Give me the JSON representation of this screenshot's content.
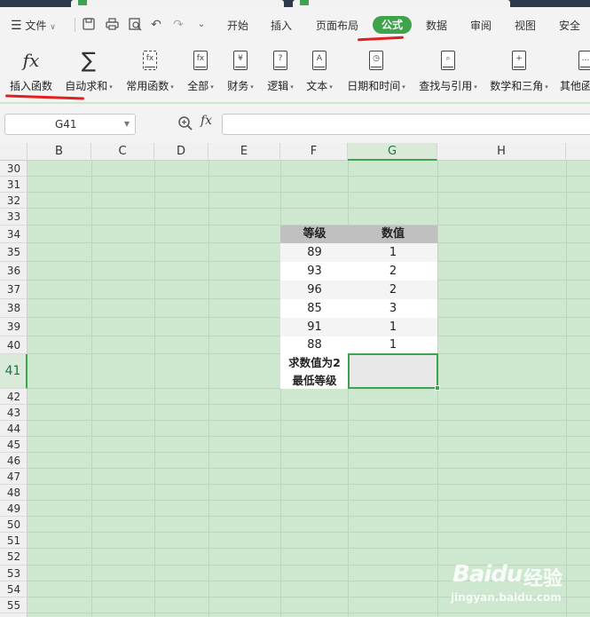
{
  "menu": {
    "file_label": "文件",
    "tabs": [
      "开始",
      "插入",
      "页面布局",
      "公式",
      "数据",
      "审阅",
      "视图",
      "安全"
    ],
    "active_tab": "公式"
  },
  "ribbon": {
    "items": [
      {
        "label": "插入函数",
        "icon": "fx-icon",
        "dropdown": false
      },
      {
        "label": "自动求和",
        "icon": "sigma-icon",
        "dropdown": true
      },
      {
        "label": "常用函数",
        "icon": "star-function-icon",
        "dropdown": true
      },
      {
        "label": "全部",
        "icon": "fx-book-icon",
        "dropdown": true
      },
      {
        "label": "财务",
        "icon": "yen-book-icon",
        "dropdown": true
      },
      {
        "label": "逻辑",
        "icon": "question-book-icon",
        "dropdown": true
      },
      {
        "label": "文本",
        "icon": "text-book-icon",
        "dropdown": true
      },
      {
        "label": "日期和时间",
        "icon": "clock-book-icon",
        "dropdown": true
      },
      {
        "label": "查找与引用",
        "icon": "search-book-icon",
        "dropdown": true
      },
      {
        "label": "数学和三角",
        "icon": "math-book-icon",
        "dropdown": true
      },
      {
        "label": "其他函",
        "icon": "other-book-icon",
        "dropdown": false
      }
    ]
  },
  "formula_bar": {
    "cell_ref": "G41",
    "fx_label": "fx",
    "value": ""
  },
  "columns": [
    "B",
    "C",
    "D",
    "E",
    "F",
    "G",
    "H"
  ],
  "active_column": "G",
  "rows": [
    "30",
    "31",
    "32",
    "33",
    "34",
    "35",
    "36",
    "37",
    "38",
    "39",
    "40",
    "41",
    "42",
    "43",
    "44",
    "45",
    "46",
    "47",
    "48",
    "49",
    "50",
    "51",
    "52",
    "53",
    "54",
    "55"
  ],
  "active_row": "41",
  "table": {
    "headers": [
      "等级",
      "数值"
    ],
    "rows": [
      [
        "89",
        "1"
      ],
      [
        "93",
        "2"
      ],
      [
        "96",
        "2"
      ],
      [
        "85",
        "3"
      ],
      [
        "91",
        "1"
      ],
      [
        "88",
        "1"
      ]
    ],
    "label_line1": "求数值为2",
    "label_line2": "最低等级",
    "result": ""
  },
  "watermark": {
    "brand": "Baidu",
    "cn": "经验",
    "url": "jingyan.baidu.com"
  },
  "colors": {
    "accent": "#3fa34d",
    "sheet_bg": "#cde8cf",
    "annotation": "#e02020"
  }
}
